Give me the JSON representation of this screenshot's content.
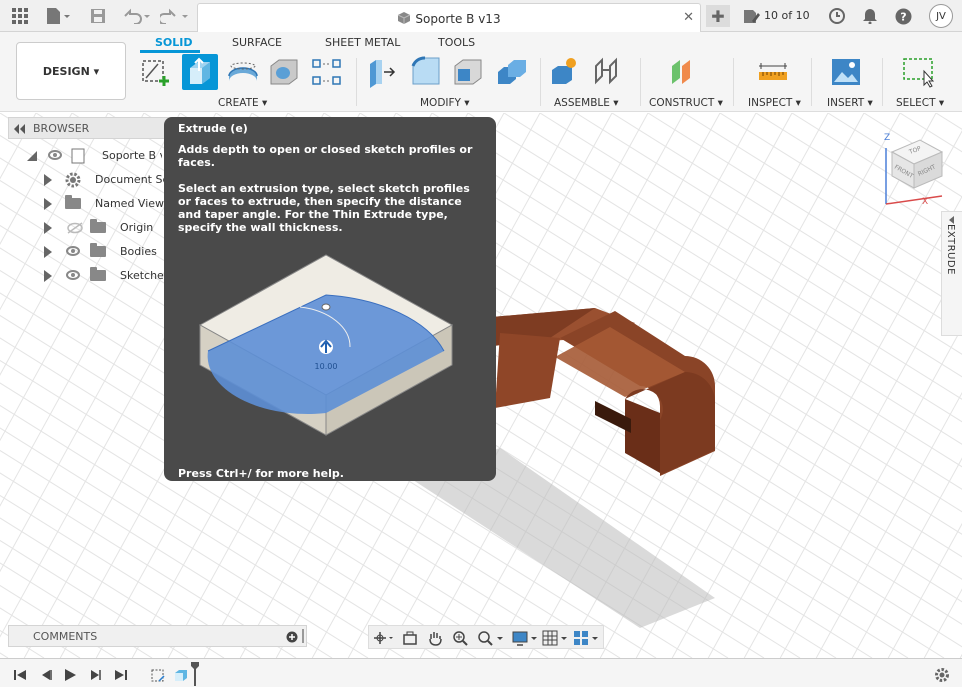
{
  "app": {
    "doc_title": "Soporte B v13",
    "version_label": "10 of 10",
    "user_initials": "JV"
  },
  "toolbar": {
    "design_label": "DESIGN ▾",
    "tabs": [
      "SOLID",
      "SURFACE",
      "SHEET METAL",
      "TOOLS"
    ],
    "groups": [
      "CREATE ▾",
      "MODIFY ▾",
      "ASSEMBLE ▾",
      "CONSTRUCT ▾",
      "INSPECT ▾",
      "INSERT ▾",
      "SELECT ▾"
    ]
  },
  "browser": {
    "title": "BROWSER",
    "root_label": "Soporte B v",
    "items": [
      "Document Setti",
      "Named Views",
      "Origin",
      "Bodies",
      "Sketches"
    ]
  },
  "tooltip": {
    "title": "Extrude (e)",
    "p1": "Adds depth to open or closed sketch profiles or faces.",
    "p2": "Select an extrusion type, select sketch profiles or faces to extrude, then specify the distance and taper angle. For the Thin Extrude type, specify the wall thickness.",
    "dimension": "10.00",
    "footer": "Press Ctrl+/ for more help."
  },
  "side_panel": {
    "label": "EXTRUDE"
  },
  "viewcube": {
    "top": "TOP",
    "front": "FRONT",
    "right": "RIGHT",
    "axis_z": "Z",
    "axis_x": "X"
  },
  "comments": {
    "label": "COMMENTS"
  },
  "colors": {
    "accent": "#0696d7",
    "tooltip_bg": "#4a4a4a",
    "wood": "#7a3a22"
  }
}
